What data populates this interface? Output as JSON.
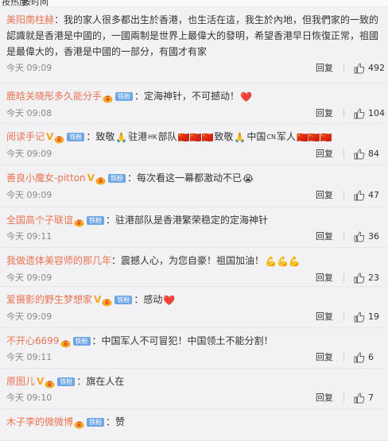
{
  "top_tabs": [
    "按热度",
    "按时间"
  ],
  "comments": [
    {
      "user": "美阳南柱赫",
      "user_color": "orange",
      "badges": [],
      "text_lines": [
        "：我的家人很多都出生於香港，也生活在這，我生於內地，但我們家的一致的",
        "認識就是香港是中國的，一國兩制是世界上最偉大的發明，希望香港早日恢復正常，祖國",
        "是最偉大的，香港是中國的一部分，有國才有家"
      ],
      "time": "今天 09:09",
      "reply": "回复",
      "likes": "492"
    },
    {
      "user": "鹿晗关晓彤多久能分手",
      "user_color": "orange",
      "badges": [
        "fire",
        "铁粉"
      ],
      "text": "：定海神针，不可撼动！",
      "trailing_emoji": "❤️",
      "time": "今天 09:08",
      "reply": "回复",
      "likes": "104"
    },
    {
      "user": "阅读手记",
      "user_color": "orange",
      "badges": [
        "V",
        "fire",
        "铁粉"
      ],
      "text_parts": [
        "：致敬",
        "🙏",
        "驻港",
        "HK",
        "部队",
        "🇨🇳🇨🇳🇨🇳",
        "致敬",
        "🙏",
        "中国",
        "CN",
        "军人",
        "🇨🇳🇨🇳🇨🇳"
      ],
      "time": "今天 09:09",
      "reply": "回复",
      "likes": "84"
    },
    {
      "user": "善良小魔女-pitton",
      "user_color": "orange",
      "badges": [
        "V",
        "fire",
        "铁粉"
      ],
      "text": "：每次看这一幕都激动不已",
      "trailing_emoji": "😭",
      "time": "今天 09:09",
      "reply": "回复",
      "likes": "47"
    },
    {
      "user": "全国高个子联谊",
      "user_color": "orange",
      "badges": [
        "fire",
        "铁粉"
      ],
      "text": "：驻港部队是香港繁荣稳定的定海神针",
      "time": "今天 09:11",
      "reply": "回复",
      "likes": "36"
    },
    {
      "user": "我做遗体美容师的那几年",
      "user_color": "orange",
      "badges": [],
      "text": "：震撼人心，为您自豪！祖国加油！",
      "trailing_emoji": "💪💪💪",
      "time": "今天 09:09",
      "reply": "回复",
      "likes": "23"
    },
    {
      "user": "爱摄影的野生梦想家",
      "user_color": "orange",
      "badges": [
        "V",
        "fire",
        "铁粉"
      ],
      "text": "：感动",
      "trailing_emoji": "❤️",
      "time": "今天 09:09",
      "reply": "回复",
      "likes": "19"
    },
    {
      "user": "不开心6699",
      "user_color": "orange",
      "badges": [
        "fire",
        "铁粉"
      ],
      "text": "：中国军人不可冒犯！中国领土不能分割！",
      "time": "今天 09:11",
      "reply": "回复",
      "likes": "6"
    },
    {
      "user": "原图儿",
      "user_color": "orange",
      "badges": [
        "V",
        "fire",
        "铁粉"
      ],
      "text": "：旗在人在",
      "time": "今天 09:10",
      "reply": "回复",
      "likes": "7"
    },
    {
      "user": "木子李的微微博",
      "user_color": "orange",
      "badges": [
        "fire",
        "铁粉"
      ],
      "text": "：赞",
      "time": "",
      "reply": "",
      "likes": ""
    }
  ],
  "colors": {
    "username": "#eb7350",
    "badge": "#6ea6e5",
    "v_badge": "#f5a623",
    "background": "#f2f2f5"
  },
  "icons": {
    "like": "thumbs-up-icon",
    "fire": "fire-fan-icon",
    "flag": "china-flag-emoji"
  }
}
